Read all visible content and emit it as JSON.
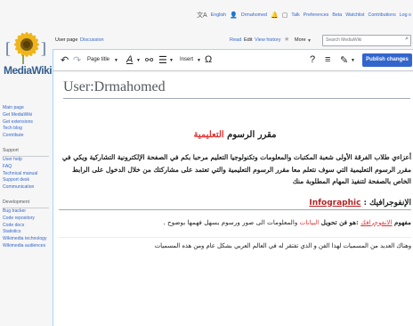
{
  "personal": {
    "language": "English",
    "username": "Drmahomed",
    "talk": "Talk",
    "preferences": "Preferences",
    "beta": "Beta",
    "watchlist": "Watchlist",
    "contributions": "Contributions",
    "logout": "Log o"
  },
  "logo_text": "MediaWiki",
  "sidebar": {
    "nav": [
      "Main page",
      "Get MediaWiki",
      "Get extensions",
      "Tech blog",
      "Contribute"
    ],
    "support_heading": "Support",
    "support": [
      "User help",
      "FAQ",
      "Technical manual",
      "Support desk",
      "Communication"
    ],
    "development_heading": "Development",
    "development": [
      "Bug tracker",
      "Code repository",
      "Code docs",
      "Statistics",
      "Wikimedia technology",
      "Wikimedia audiences"
    ]
  },
  "tabs": {
    "user_page": "User page",
    "discussion": "Discussion",
    "read": "Read",
    "edit": "Edit",
    "view_history": "View history",
    "more": "More",
    "search_placeholder": "Search MediaWiki"
  },
  "toolbar": {
    "paragraph": "Page title",
    "insert": "Insert",
    "publish": "Publish changes"
  },
  "page_title": "User:Drmahomed",
  "article": {
    "heading_main": "مقرر الرسوم ",
    "heading_link": "التعليمية",
    "intro": "أعزاءي طلاب الفرقة الأولى شعبة المكتبات والمعلومات وتكنولوجيا التعليم مرحبا بكم في الصفحة الإلكترونية التشاركية ويكي في مقرر الرسوم التعليمية التي سوف نتعلم معا مقرر الرسوم التعليمية والتي تعتمد على مشاركتك من خلال الدخول على الرابط الخاص بالصفحة لتنفيذ المهام المطلوبة منك",
    "section_ar": "الإنفوجرافيك : ",
    "section_en": "Infographic",
    "def_bold": "مفهوم ",
    "def_link": "الانفوجرافك",
    "def_mid": " :هو فن تحويل ",
    "def_link2": "البيانات",
    "def_end": " والمعلومات الى صور ورسوم يسهل فهمها بوضوح .",
    "last_para": "وهناك العديد من المسميات لهذا الفن و الذي تفتقر له في العالم العربي بشكل عام ومن هذه المسميات"
  }
}
